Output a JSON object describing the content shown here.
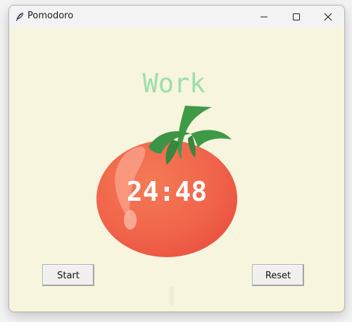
{
  "window": {
    "title": "Pomodoro",
    "controls": [
      "minimize-icon",
      "maximize-icon",
      "close-icon"
    ]
  },
  "app": {
    "mode_label": "Work",
    "timer": "24:48",
    "start_label": "Start",
    "reset_label": "Reset",
    "checkmarks": ""
  },
  "colors": {
    "background": "#f7f5dd",
    "mode_label": "#9bdeac",
    "tomato": "#ef5b43",
    "leaves": "#3f9a48",
    "timer_text": "#ffffff"
  }
}
